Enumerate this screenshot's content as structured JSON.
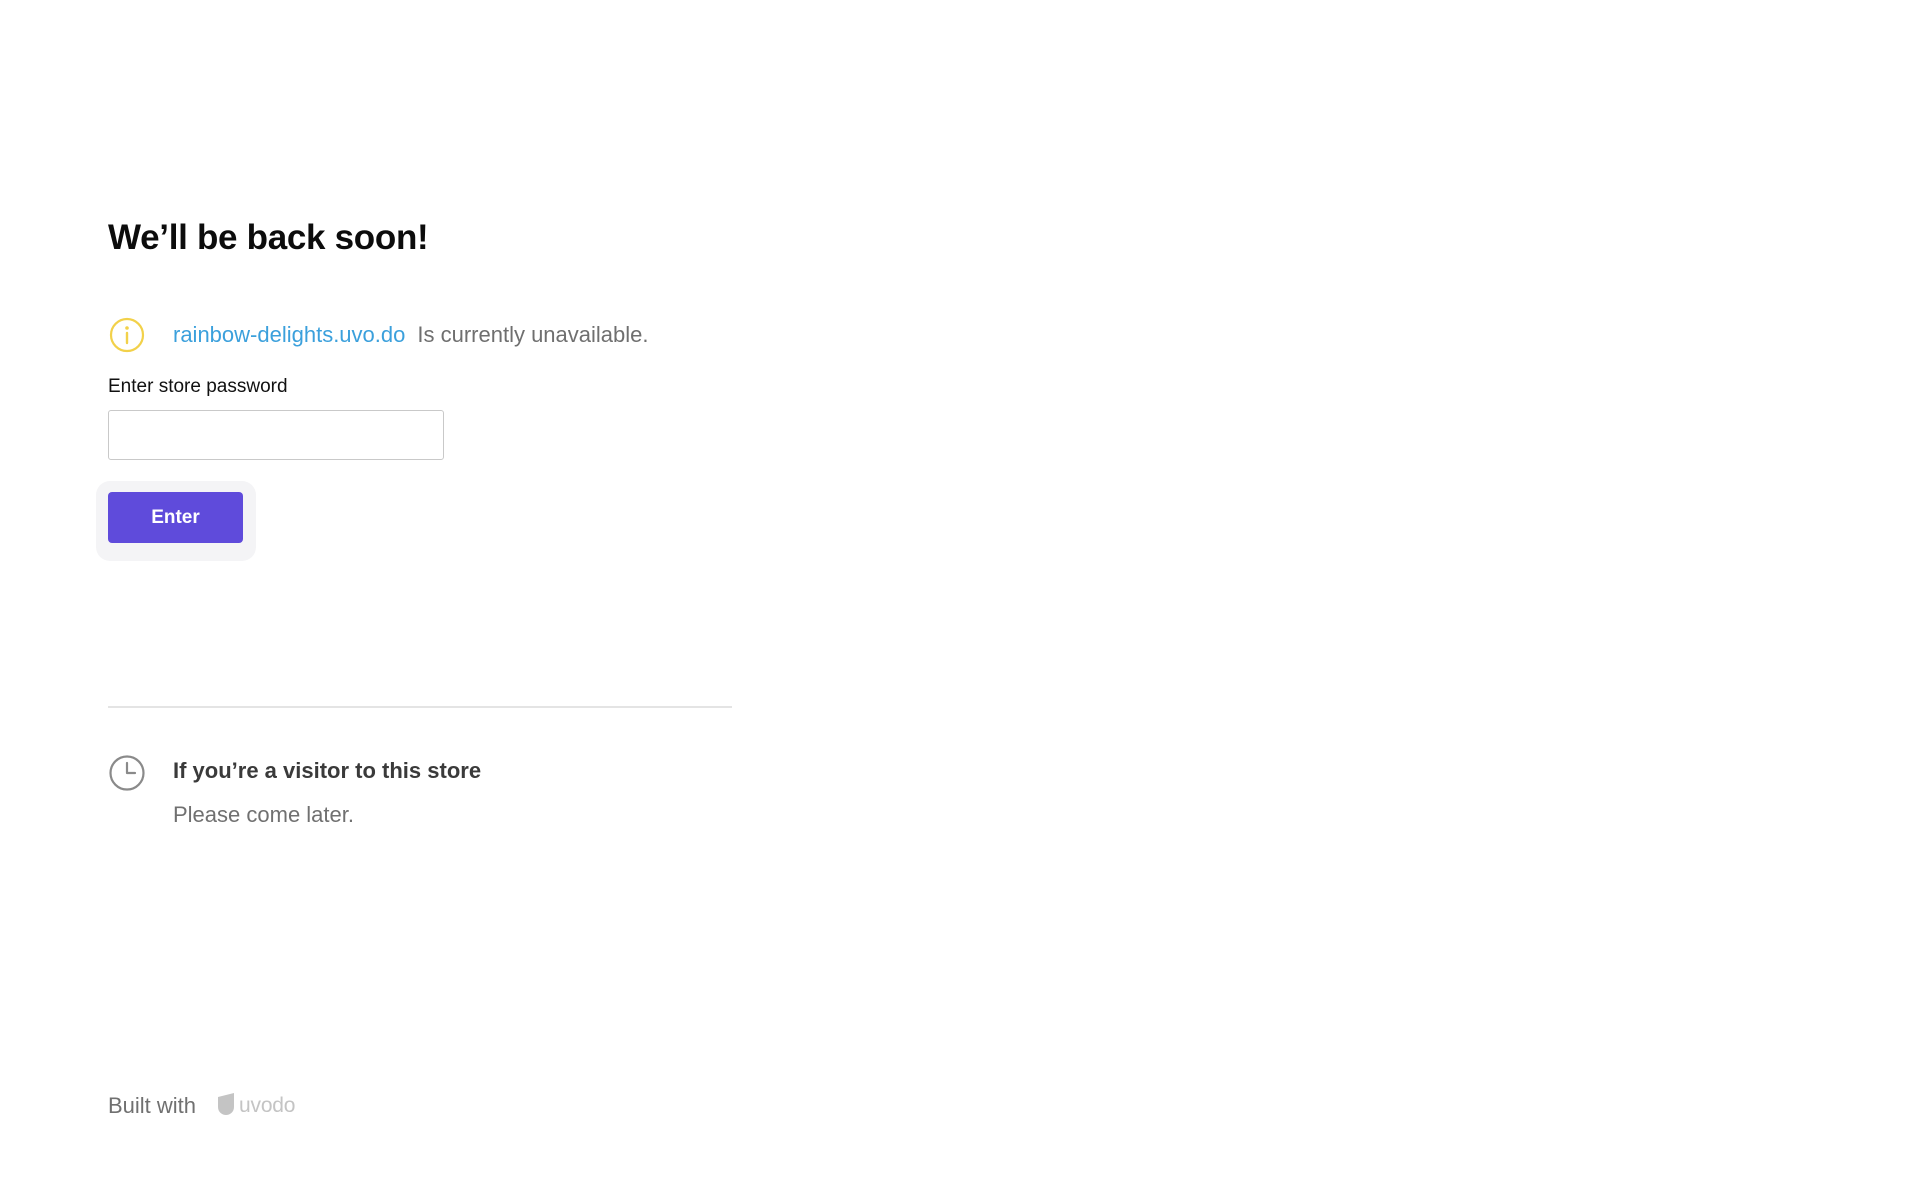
{
  "heading": {
    "title": "We’ll be back soon!"
  },
  "notice": {
    "icon": "info-icon",
    "icon_color": "#f2d14a",
    "store_domain": "rainbow-delights.uvo.do",
    "store_domain_color": "#3ba0dc",
    "status_text": "Is currently unavailable."
  },
  "password_form": {
    "label": "Enter store password",
    "value": "",
    "placeholder": "",
    "submit_label": "Enter",
    "submit_color": "#5f4bdb"
  },
  "visitor_info": {
    "icon": "clock-icon",
    "title": "If you’re a visitor to this store",
    "text": "Please come later."
  },
  "footer": {
    "built_with_label": "Built with",
    "brand_icon": "uvodo-logo-icon",
    "brand_name": "uvodo"
  }
}
